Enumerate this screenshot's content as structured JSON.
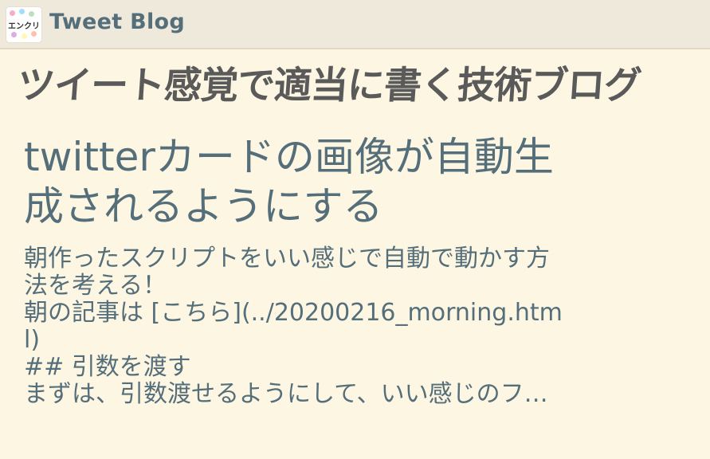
{
  "header": {
    "logo_text": "エンクリ",
    "site_name": "Tweet Blog"
  },
  "blog_title": "ツイート感覚で適当に書く技術ブログ",
  "post": {
    "title_line_1": "twitterカードの画像が自動生",
    "title_line_2": "成されるようにする",
    "excerpt_lines": [
      "朝作ったスクリプトをいい感じで自動で動かす方",
      "法を考える！",
      "朝の記事は [こちら](../20200216_morning.htm",
      "l)",
      "## 引数を渡す",
      "まずは、引数渡せるようにして、いい感じのフ…"
    ]
  }
}
